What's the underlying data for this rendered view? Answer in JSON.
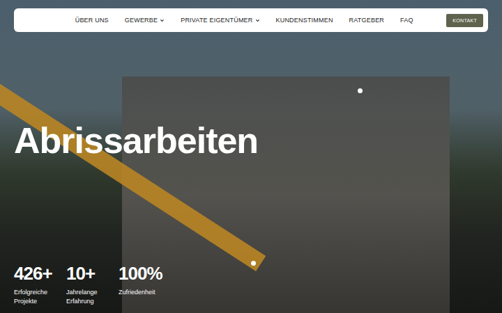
{
  "nav": {
    "items": [
      {
        "label": "ÜBER UNS",
        "kind": "link"
      },
      {
        "label": "GEWERBE",
        "kind": "dropdown"
      },
      {
        "label": "PRIVATE EIGENTÜMER",
        "kind": "dropdown"
      },
      {
        "label": "KUNDENSTIMMEN",
        "kind": "link"
      },
      {
        "label": "RATGEBER",
        "kind": "link"
      },
      {
        "label": "FAQ",
        "kind": "link"
      }
    ],
    "button": "KONTAKT"
  },
  "hero": {
    "title": "Abrissarbeiten",
    "stats": [
      {
        "value": "426+",
        "label": "Erfolgreiche Projekte"
      },
      {
        "value": "10+",
        "label": "Jahrelange Erfahrung"
      },
      {
        "value": "100%",
        "label": "Zufriedenheit"
      }
    ]
  }
}
